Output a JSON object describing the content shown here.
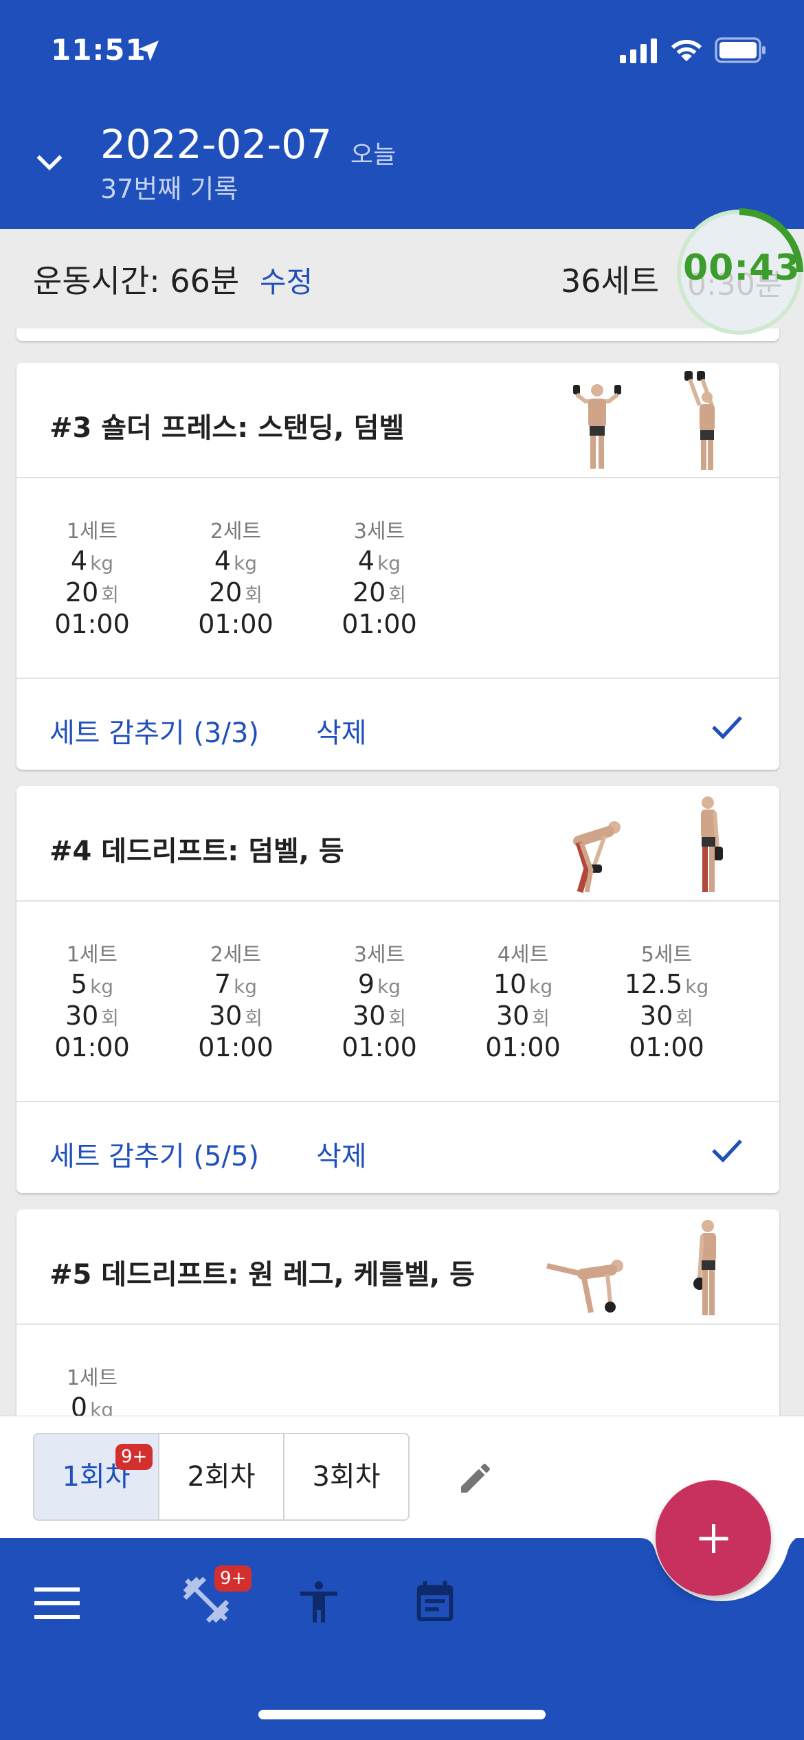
{
  "status_bar": {
    "time": "11:51"
  },
  "header": {
    "date": "2022-02-07",
    "today": "오늘",
    "record_count": "37번째 기록"
  },
  "summary": {
    "duration": "운동시간: 66분",
    "edit": "수정",
    "sets": "36세트",
    "timer": "00:43",
    "timer_bg": "0:30분"
  },
  "exercises": [
    {
      "title": "#3 숄더 프레스: 스탠딩, 덤벨",
      "sets": [
        {
          "label": "1세트",
          "weight": "4",
          "weight_unit": "kg",
          "reps": "20",
          "reps_unit": "회",
          "time": "01:00"
        },
        {
          "label": "2세트",
          "weight": "4",
          "weight_unit": "kg",
          "reps": "20",
          "reps_unit": "회",
          "time": "01:00"
        },
        {
          "label": "3세트",
          "weight": "4",
          "weight_unit": "kg",
          "reps": "20",
          "reps_unit": "회",
          "time": "01:00"
        }
      ],
      "hide_label": "세트 감추기 (3/3)",
      "delete_label": "삭제"
    },
    {
      "title": "#4 데드리프트: 덤벨, 등",
      "sets": [
        {
          "label": "1세트",
          "weight": "5",
          "weight_unit": "kg",
          "reps": "30",
          "reps_unit": "회",
          "time": "01:00"
        },
        {
          "label": "2세트",
          "weight": "7",
          "weight_unit": "kg",
          "reps": "30",
          "reps_unit": "회",
          "time": "01:00"
        },
        {
          "label": "3세트",
          "weight": "9",
          "weight_unit": "kg",
          "reps": "30",
          "reps_unit": "회",
          "time": "01:00"
        },
        {
          "label": "4세트",
          "weight": "10",
          "weight_unit": "kg",
          "reps": "30",
          "reps_unit": "회",
          "time": "01:00"
        },
        {
          "label": "5세트",
          "weight": "12.5",
          "weight_unit": "kg",
          "reps": "30",
          "reps_unit": "회",
          "time": "01:00"
        }
      ],
      "hide_label": "세트 감추기 (5/5)",
      "delete_label": "삭제"
    },
    {
      "title": "#5 데드리프트: 원 레그, 케틀벨, 등",
      "sets": [
        {
          "label": "1세트",
          "weight": "0",
          "weight_unit": "kg"
        }
      ]
    }
  ],
  "round_tabs": {
    "items": [
      "1회차",
      "2회차",
      "3회차"
    ],
    "active": 0,
    "badge": "9+"
  },
  "bottom_nav": {
    "badge": "9+"
  },
  "colors": {
    "primary": "#1e4fbb",
    "accent": "#c8315e",
    "timer": "#3c9d2c",
    "badge": "#d32f2f"
  },
  "icons": [
    "location-arrow-icon",
    "signal-icon",
    "wifi-icon",
    "battery-icon",
    "chevron-down-icon",
    "check-icon",
    "pencil-icon",
    "menu-icon",
    "dumbbell-icon",
    "person-icon",
    "calendar-icon",
    "plus-icon"
  ]
}
